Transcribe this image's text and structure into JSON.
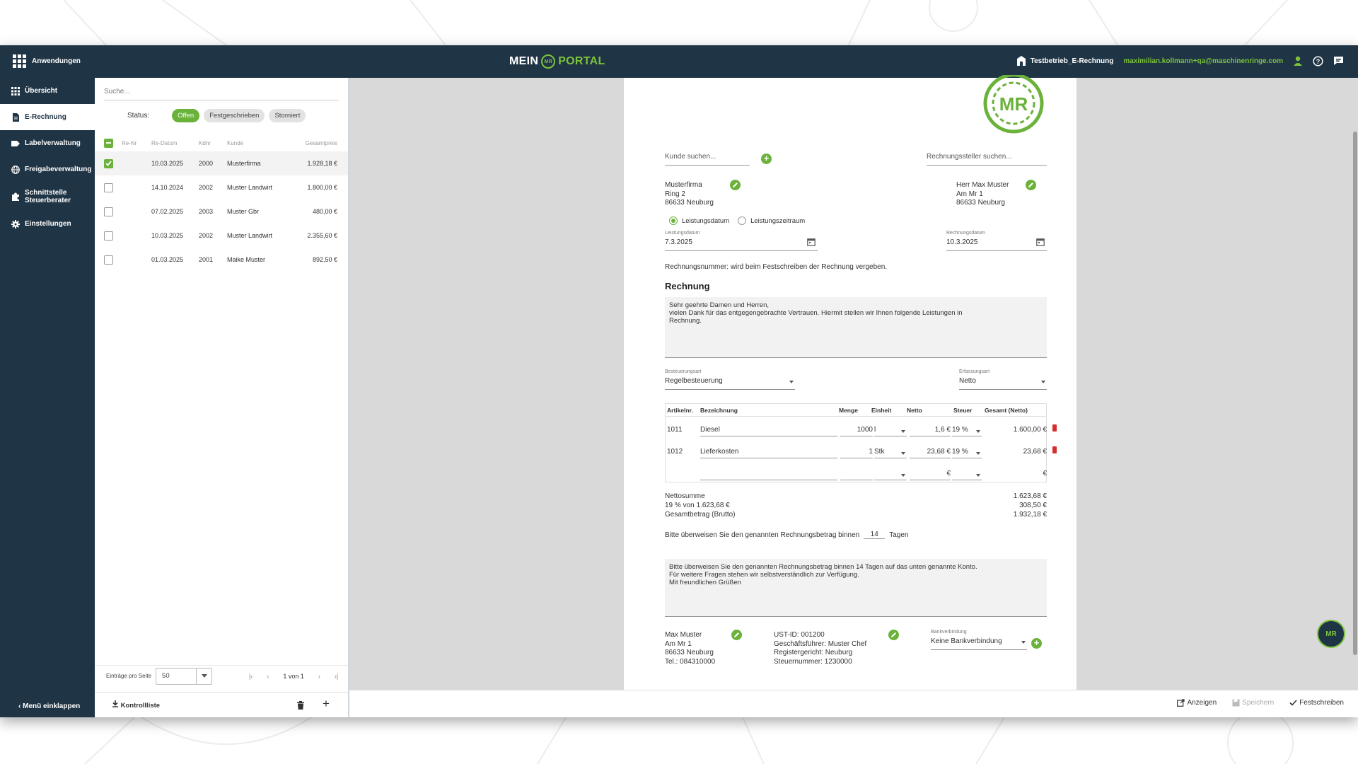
{
  "topbar": {
    "apps_label": "Anwendungen",
    "brand_left": "MEIN",
    "brand_logo": "MR",
    "brand_right": "PORTAL",
    "company": "Testbetrieb_E-Rechnung",
    "email": "maximilian.kollmann+qa@maschinenringe.com"
  },
  "sidebar": {
    "items": [
      {
        "label": "Übersicht",
        "icon": "grid-icon"
      },
      {
        "label": "E-Rechnung",
        "icon": "document-icon"
      },
      {
        "label": "Labelverwaltung",
        "icon": "label-icon"
      },
      {
        "label": "Freigabeverwaltung",
        "icon": "globe-icon"
      },
      {
        "label": "Schnittstelle",
        "label2": "Steuerberater",
        "icon": "puzzle-icon"
      },
      {
        "label": "Einstellungen",
        "icon": "gear-icon"
      }
    ],
    "collapse_label": "Menü einklappen"
  },
  "list": {
    "search_placeholder": "Suche...",
    "status_label": "Status:",
    "chips": [
      "Offen",
      "Festgeschrieben",
      "Storniert"
    ],
    "columns": [
      "Re-Nr",
      "Re-Datum",
      "Kdnr",
      "Kunde",
      "Gesamtpreis"
    ],
    "rows": [
      {
        "nr": "",
        "date": "10.03.2025",
        "kdnr": "2000",
        "kunde": "Musterfirma",
        "preis": "1.928,18 €",
        "checked": true
      },
      {
        "nr": "",
        "date": "14.10.2024",
        "kdnr": "2002",
        "kunde": "Muster Landwirt",
        "preis": "1.800,00 €",
        "checked": false
      },
      {
        "nr": "",
        "date": "07.02.2025",
        "kdnr": "2003",
        "kunde": "Muster Gbr",
        "preis": "480,00 €",
        "checked": false
      },
      {
        "nr": "",
        "date": "10.03.2025",
        "kdnr": "2002",
        "kunde": "Muster Landwirt",
        "preis": "2.355,60 €",
        "checked": false
      },
      {
        "nr": "",
        "date": "01.03.2025",
        "kdnr": "2001",
        "kunde": "Maike Muster",
        "preis": "892,50 €",
        "checked": false
      }
    ],
    "per_page_label": "Einträge pro Seite",
    "per_page_value": "50",
    "page_info": "1 von 1",
    "kontrollliste_label": "Kontrollliste"
  },
  "invoice": {
    "logo_text": "MR",
    "customer_search": "Kunde suchen...",
    "issuer_search": "Rechnungssteller suchen...",
    "customer": {
      "name": "Musterfirma",
      "street": "Ring 2",
      "city": "86633 Neuburg"
    },
    "issuer": {
      "name": "Herr Max Muster",
      "street": "Am Mr 1",
      "city": "86633 Neuburg"
    },
    "radio_1": "Leistungsdatum",
    "radio_2": "Leistungszeitraum",
    "service_date_label": "Leistungsdatum",
    "service_date": "7.3.2025",
    "invoice_date_label": "Rechnungsdatum",
    "invoice_date": "10.3.2025",
    "invoice_number_note": "Rechnungsnummer: wird beim Festschreiben der Rechnung vergeben.",
    "heading": "Rechnung",
    "intro_1": "Sehr geehrte Damen und Herren,",
    "intro_2": "vielen Dank für das entgegengebrachte Vertrauen. Hiermit stellen wir Ihnen folgende Leistungen in",
    "intro_3": "Rechnung.",
    "tax_type_label": "Besteuerungsart",
    "tax_type": "Regelbesteuerung",
    "entry_type_label": "Erfassungsart",
    "entry_type": "Netto",
    "table_headers": [
      "Artikelnr.",
      "Bezeichnung",
      "Menge",
      "Einheit",
      "Netto",
      "Steuer",
      "Gesamt (Netto)"
    ],
    "items": [
      {
        "art": "1011",
        "desc": "Diesel",
        "qty": "1000",
        "unit": "l",
        "net": "1,6 €",
        "tax": "19 %",
        "total": "1.600,00 €"
      },
      {
        "art": "1012",
        "desc": "Lieferkosten",
        "qty": "1",
        "unit": "Stk",
        "net": "23,68 €",
        "tax": "19 %",
        "total": "23,68 €"
      }
    ],
    "empty_net": "€",
    "empty_total": "€",
    "net_sum_label": "Nettosumme",
    "net_sum": "1.623,68 €",
    "vat_label": "19 % von 1.623,68 €",
    "vat": "308,50 €",
    "gross_label": "Gesamtbetrag (Brutto)",
    "gross": "1.932,18 €",
    "payment_prefix": "Bitte überweisen Sie den genannten Rechnungsbetrag binnen",
    "payment_days": "14",
    "payment_suffix": "Tagen",
    "closing_1": "Bitte überweisen Sie den genannten Rechnungsbetrag binnen 14 Tagen auf das unten genannte Konto.",
    "closing_2": "Für weitere Fragen stehen wir selbstverständlich zur Verfügung.",
    "closing_3": "Mit freundlichen Grüßen",
    "footer_left": {
      "name": "Max Muster",
      "street": "Am Mr 1",
      "city": "86633 Neuburg",
      "tel": "Tel.: 084310000"
    },
    "footer_mid": {
      "ust": "UST-ID: 001200",
      "gf": "Geschäftsführer: Muster Chef",
      "reg": "Registergericht: Neuburg",
      "steuer": "Steuernummer: 1230000"
    },
    "bank_label": "Bankverbindung",
    "bank_value": "Keine Bankverbindung"
  },
  "fab_label": "MR",
  "actions": {
    "show": "Anzeigen",
    "save": "Speichern",
    "commit": "Festschreiben"
  },
  "colors": {
    "navy": "#1f3445",
    "green": "#6ab23a",
    "brand_green": "#7cc33c"
  }
}
